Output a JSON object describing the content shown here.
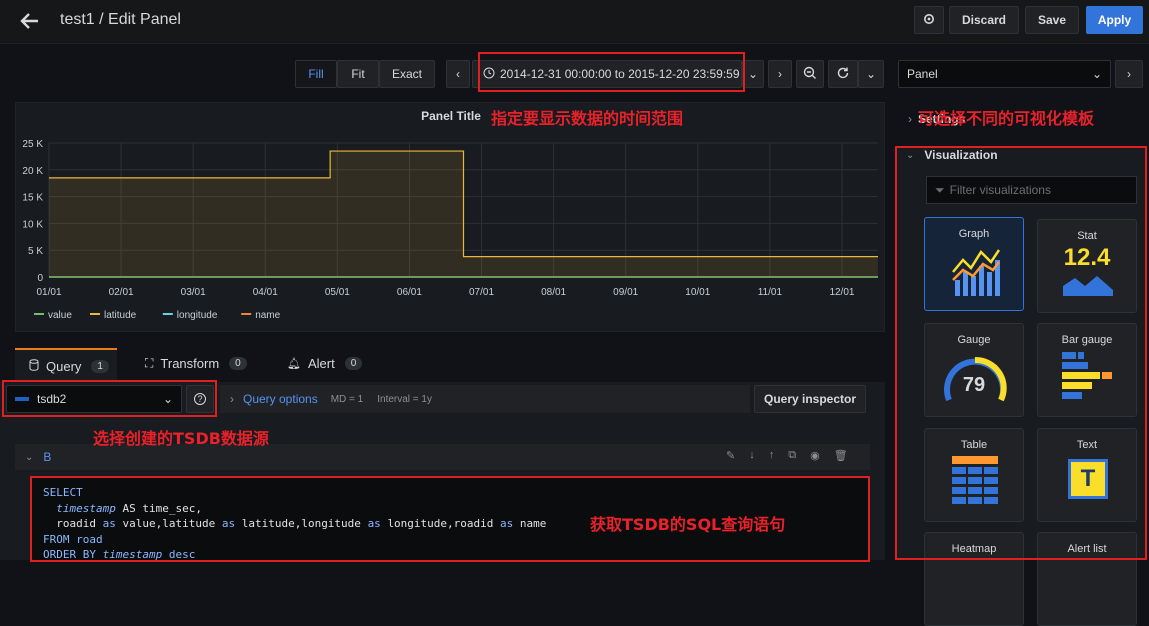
{
  "header": {
    "title": "test1 / Edit Panel",
    "discard": "Discard",
    "save": "Save",
    "apply": "Apply"
  },
  "toolbar": {
    "fill": "Fill",
    "fit": "Fit",
    "exact": "Exact",
    "time_range": "2014-12-31 00:00:00 to 2015-12-20 23:59:59"
  },
  "right": {
    "panel_select": "Panel",
    "settings": "Settings",
    "visualization": "Visualization",
    "filter_placeholder": "Filter visualizations",
    "cards": [
      {
        "label": "Graph"
      },
      {
        "label": "Stat",
        "value": "12.4"
      },
      {
        "label": "Gauge",
        "value": "79"
      },
      {
        "label": "Bar gauge"
      },
      {
        "label": "Table"
      },
      {
        "label": "Text",
        "value": "T"
      },
      {
        "label": "Heatmap"
      },
      {
        "label": "Alert list"
      }
    ]
  },
  "tabs": {
    "query": "Query",
    "query_count": "1",
    "transform": "Transform",
    "transform_count": "0",
    "alert": "Alert",
    "alert_count": "0"
  },
  "datasource": {
    "name": "tsdb2",
    "query_options": "Query options",
    "md": "MD = 1",
    "interval": "Interval = 1y",
    "inspector": "Query inspector"
  },
  "query": {
    "ref": "B",
    "sql": [
      "SELECT",
      "timestamp",
      "AS time_sec,",
      "roadid",
      "as",
      "value,latitude",
      "as",
      "latitude,longitude",
      "as",
      "longitude,roadid",
      "as",
      "name",
      "FROM road",
      "ORDER BY",
      "timestamp",
      "desc"
    ]
  },
  "annotations": {
    "time_range": "指定要显示数据的时间范围",
    "viz": "可选择不同的可视化模板",
    "datasource": "选择创建的TSDB数据源",
    "sql": "获取TSDB的SQL查询语句"
  },
  "chart_data": {
    "type": "line",
    "title": "Panel Title",
    "categories": [
      "01/01",
      "02/01",
      "03/01",
      "04/01",
      "05/01",
      "06/01",
      "07/01",
      "08/01",
      "09/01",
      "10/01",
      "11/01",
      "12/01"
    ],
    "y_ticks": [
      "0",
      "5 K",
      "10 K",
      "15 K",
      "20 K",
      "25 K"
    ],
    "ylim": [
      0,
      25000
    ],
    "series": [
      {
        "name": "value",
        "color": "#73bf69",
        "x": [
          0,
          11.5
        ],
        "y": [
          0,
          0
        ]
      },
      {
        "name": "latitude",
        "color": "#eab839",
        "x": [
          0,
          3.9,
          3.9,
          5.75,
          5.75,
          11.5
        ],
        "y": [
          18500,
          18500,
          23500,
          23500,
          3800,
          3800
        ]
      },
      {
        "name": "longitude",
        "color": "#6ed0e0",
        "x": [
          0,
          11.5
        ],
        "y": [
          0,
          0
        ]
      },
      {
        "name": "name",
        "color": "#ef843c",
        "x": [
          0,
          11.5
        ],
        "y": [
          0,
          0
        ]
      }
    ],
    "legend_position": "bottom-left",
    "grid": true
  }
}
